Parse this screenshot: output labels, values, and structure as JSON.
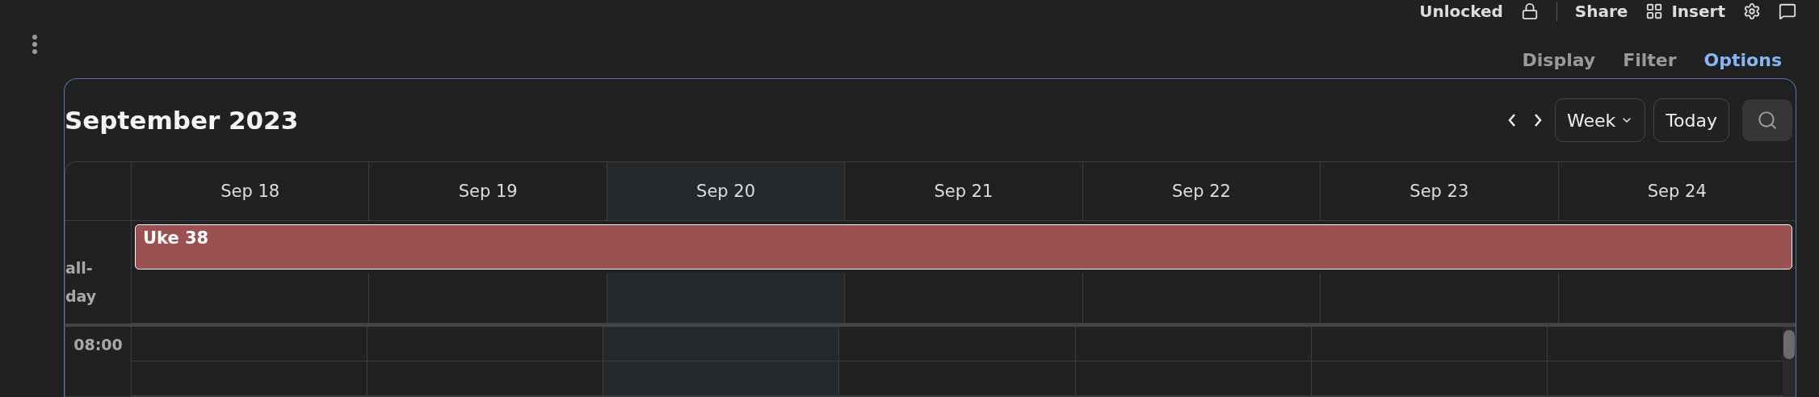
{
  "toolbar": {
    "lock_label": "Unlocked",
    "share_label": "Share",
    "insert_label": "Insert"
  },
  "view_tabs": [
    {
      "label": "Display",
      "selected": false
    },
    {
      "label": "Filter",
      "selected": false
    },
    {
      "label": "Options",
      "selected": true
    }
  ],
  "calendar": {
    "title": "September 2023",
    "view": "Week",
    "today_button": "Today",
    "days": [
      {
        "label": "Sep 18",
        "today": false
      },
      {
        "label": "Sep 19",
        "today": false
      },
      {
        "label": "Sep 20",
        "today": true
      },
      {
        "label": "Sep 21",
        "today": false
      },
      {
        "label": "Sep 22",
        "today": false
      },
      {
        "label": "Sep 23",
        "today": false
      },
      {
        "label": "Sep 24",
        "today": false
      }
    ],
    "all_day_label": "all-day",
    "events": [
      {
        "title": "Uke 38",
        "color": "#9b5151"
      }
    ],
    "times": [
      "08:00"
    ]
  }
}
